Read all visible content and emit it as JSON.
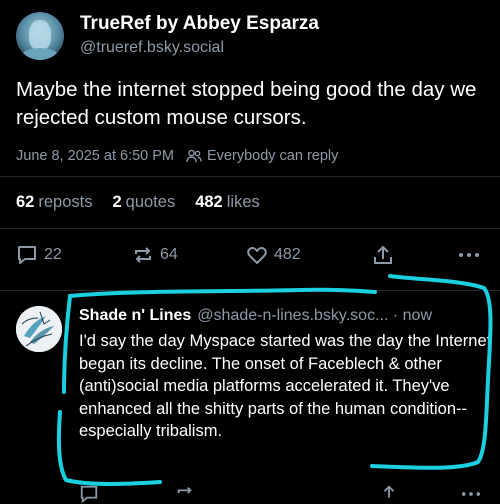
{
  "post": {
    "author_name": "TrueRef by Abbey Esparza",
    "handle": "@trueref.bsky.social",
    "text": "Maybe the internet stopped being good the day we rejected custom mouse cursors.",
    "timestamp": "June 8, 2025 at 6:50 PM",
    "reply_setting": "Everybody can reply",
    "stats": {
      "reposts_count": "62",
      "reposts_label": "reposts",
      "quotes_count": "2",
      "quotes_label": "quotes",
      "likes_count": "482",
      "likes_label": "likes"
    },
    "actions": {
      "replies": "22",
      "reposts": "64",
      "likes": "482"
    }
  },
  "reply": {
    "author_name": "Shade n' Lines",
    "handle": "@shade-n-lines.bsky.soc...",
    "separator": "·",
    "time": "now",
    "text": "I'd say the day Myspace started was the day the Internet began its decline. The onset of Faceblech & other (anti)social media platforms accelerated it. They've enhanced all the shitty parts of the human condition--especially tribalism."
  },
  "colors": {
    "background": "#000000",
    "primary_text": "#ffffff",
    "secondary_text": "#8d99a6",
    "annotation": "#1ad0e0"
  },
  "icons": [
    "chat-bubble-icon",
    "repost-icon",
    "heart-icon",
    "share-icon",
    "more-icon",
    "people-icon"
  ]
}
